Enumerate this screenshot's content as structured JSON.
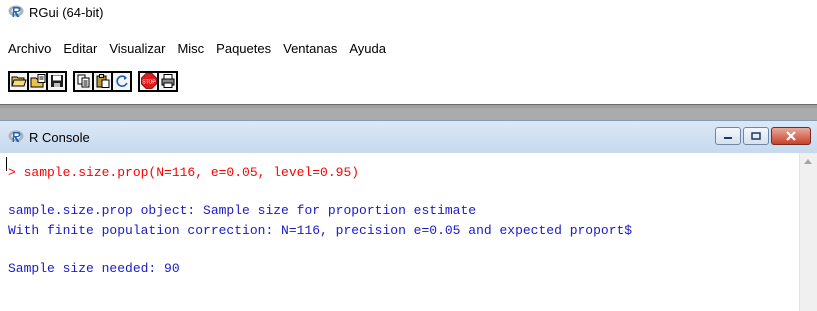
{
  "window": {
    "title": "RGui (64-bit)"
  },
  "menubar": {
    "items": [
      "Archivo",
      "Editar",
      "Visualizar",
      "Misc",
      "Paquetes",
      "Ventanas",
      "Ayuda"
    ]
  },
  "toolbar": {
    "buttons": [
      "open-script-icon",
      "load-workspace-icon",
      "save-workspace-icon",
      "copy-icon",
      "paste-icon",
      "copy-paste-icon",
      "stop-icon",
      "print-icon"
    ],
    "stop_label": "STOP"
  },
  "console": {
    "title": "R Console",
    "lines": [
      "> sample.size.prop(N=116, e=0.05, level=0.95)",
      "sample.size.prop object: Sample size for proportion estimate",
      "With finite population correction: N=116, precision e=0.05 and expected proport$",
      "Sample size needed: 90"
    ]
  },
  "colors": {
    "prompt": "#ff0000",
    "output": "#1a1acc",
    "console_title_bg": "#c6d9ee",
    "close_button": "#c8412c",
    "r_logo": "#2167b7"
  }
}
